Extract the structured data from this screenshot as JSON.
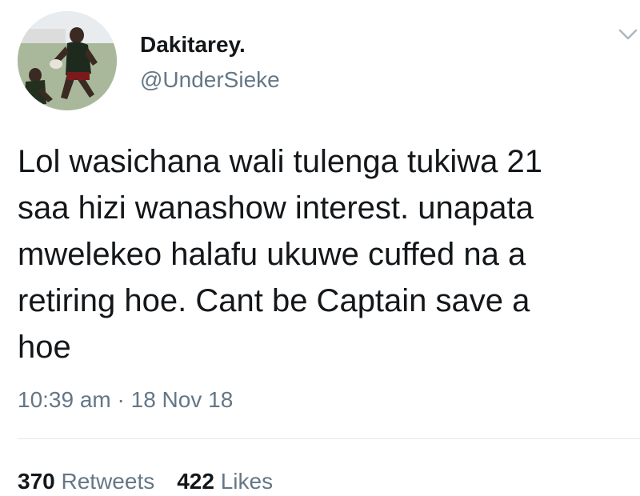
{
  "tweet": {
    "author": {
      "display_name": "Dakitarey.",
      "handle": "@UnderSieke"
    },
    "menu_icon": "chevron-down-icon",
    "text": "Lol wasichana wali tulenga tukiwa 21\nsaa hizi wanashow interest. unapata\nmwelekeo halafu ukuwe cuffed na a\nretiring hoe. Cant be Captain save a\nhoe",
    "timestamp": "10:39 am · 18 Nov 18",
    "stats": {
      "retweets_count": "370",
      "retweets_label": "Retweets",
      "likes_count": "422",
      "likes_label": "Likes"
    }
  },
  "colors": {
    "text_primary": "#14171a",
    "text_secondary": "#657786",
    "divider": "#e1e8ed"
  }
}
